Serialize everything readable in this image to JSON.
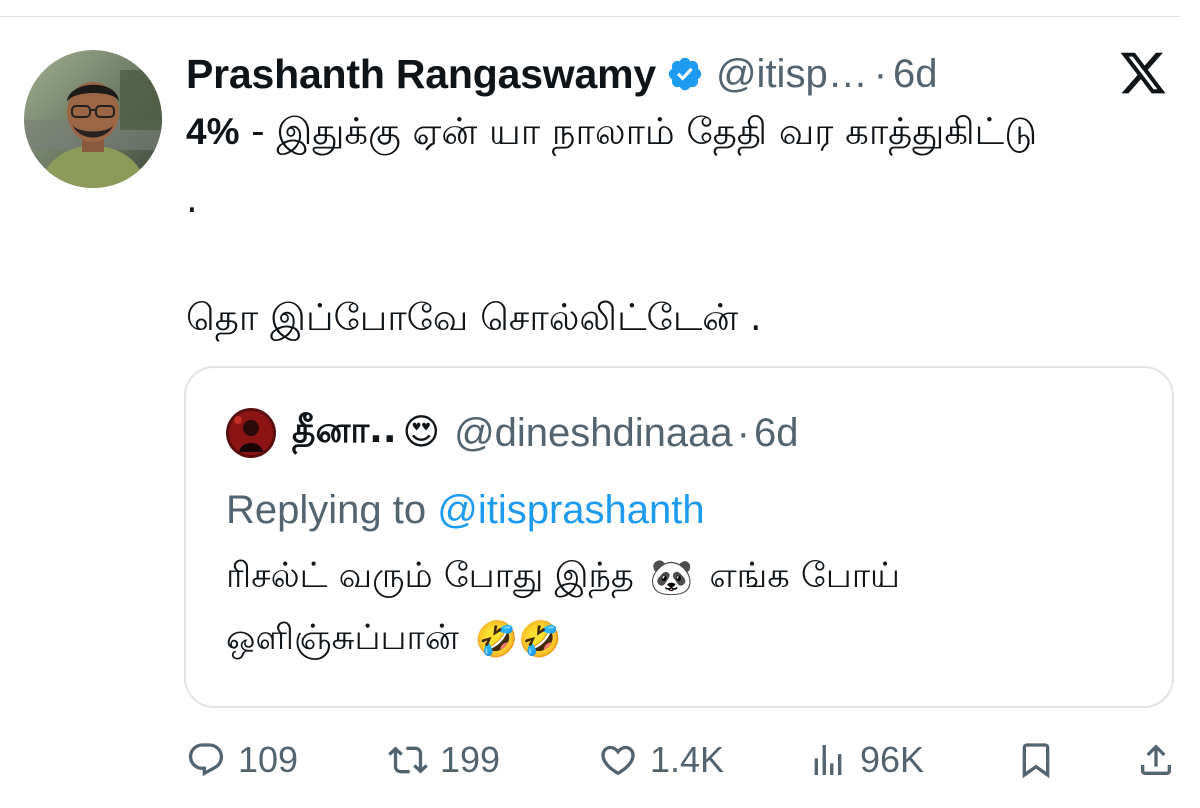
{
  "post": {
    "author": {
      "display_name": "Prashanth Rangaswamy",
      "handle": "@itisp…",
      "verified": true,
      "avatar": "profile-photo"
    },
    "separator": "·",
    "time": "6d",
    "text_line1_bold": "4%",
    "text_line1_rest": " - இதுக்கு ஏன் யா நாலாம் தேதி வர காத்துகிட்டு",
    "text_line2": ".",
    "text_line3": "தொ இப்போவே சொல்லிட்டேன் .",
    "platform_icon": "x-logo-icon"
  },
  "quote": {
    "author": {
      "display_name": "தீனா..",
      "name_emoji": "😍",
      "handle": "@dineshdinaaa",
      "avatar": "profile-photo"
    },
    "separator": "·",
    "time": "6d",
    "replying_prefix": "Replying to ",
    "replying_mention": "@itisprashanth",
    "line1_before": "ரிசல்ட் வரும் போது இந்த",
    "line1_emoji": "🐼",
    "line1_after": "எங்க போய்",
    "line2_text": "ஒளிஞ்சுப்பான்",
    "line2_emojis": "🤣🤣"
  },
  "actions": {
    "replies": "109",
    "reposts": "199",
    "likes": "1.4K",
    "views": "96K",
    "icons": [
      "reply-icon",
      "repost-icon",
      "like-icon",
      "views-icon",
      "bookmark-icon",
      "share-icon"
    ]
  },
  "colors": {
    "text": "#0f1419",
    "muted": "#536471",
    "accent": "#1d9bf0",
    "border": "#e1e5e8"
  }
}
